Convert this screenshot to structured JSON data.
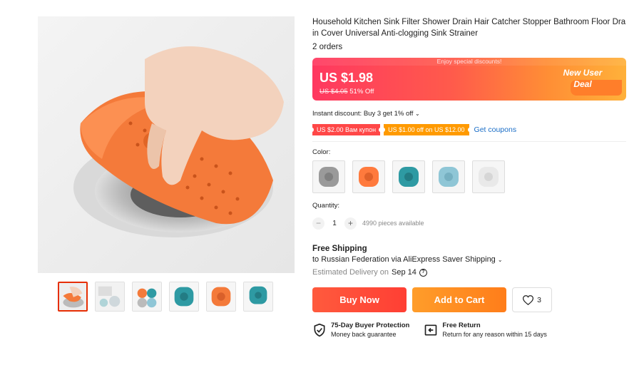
{
  "product": {
    "title": "Household Kitchen Sink Filter Shower Drain Hair Catcher Stopper Bathroom Floor Drain Cover Universal Anti-clogging Sink Strainer",
    "orders": "2 orders"
  },
  "price": {
    "banner_top": "Enjoy special discounts!",
    "current": "US $1.98",
    "original": "US $4.05",
    "discount": "51% Off",
    "deal_line1": "New User",
    "deal_line2": "Deal"
  },
  "discounts": {
    "instant": "Instant discount: Buy 3 get 1% off",
    "coupons": [
      "US $2.00 Вам купон",
      "US $1.00 off on US $12.00"
    ],
    "get_coupons": "Get coupons"
  },
  "color": {
    "label": "Color:",
    "options": [
      {
        "name": "gray",
        "hex": "#9a9a9a"
      },
      {
        "name": "orange",
        "hex": "#ff7a3d"
      },
      {
        "name": "teal",
        "hex": "#2e9aa3"
      },
      {
        "name": "light-blue",
        "hex": "#8fc6d6"
      },
      {
        "name": "white",
        "hex": "#e9e9e9"
      }
    ]
  },
  "quantity": {
    "label": "Quantity:",
    "value": "1",
    "available": "4990 pieces available"
  },
  "shipping": {
    "title": "Free Shipping",
    "line": "to Russian Federation via AliExpress Saver Shipping",
    "estimated_label": "Estimated Delivery on",
    "estimated_date": "Sep 14"
  },
  "actions": {
    "buy_now": "Buy Now",
    "add_to_cart": "Add to Cart",
    "wishlist_count": "3"
  },
  "guarantees": [
    {
      "title": "75-Day Buyer Protection",
      "subtitle": "Money back guarantee",
      "icon": "shield-check-icon"
    },
    {
      "title": "Free Return",
      "subtitle": "Return for any reason within 15 days",
      "icon": "return-icon"
    }
  ],
  "colors": {
    "accent_red": "#ff4747",
    "accent_orange": "#ff9a00",
    "link_blue": "#1b6ec7"
  }
}
